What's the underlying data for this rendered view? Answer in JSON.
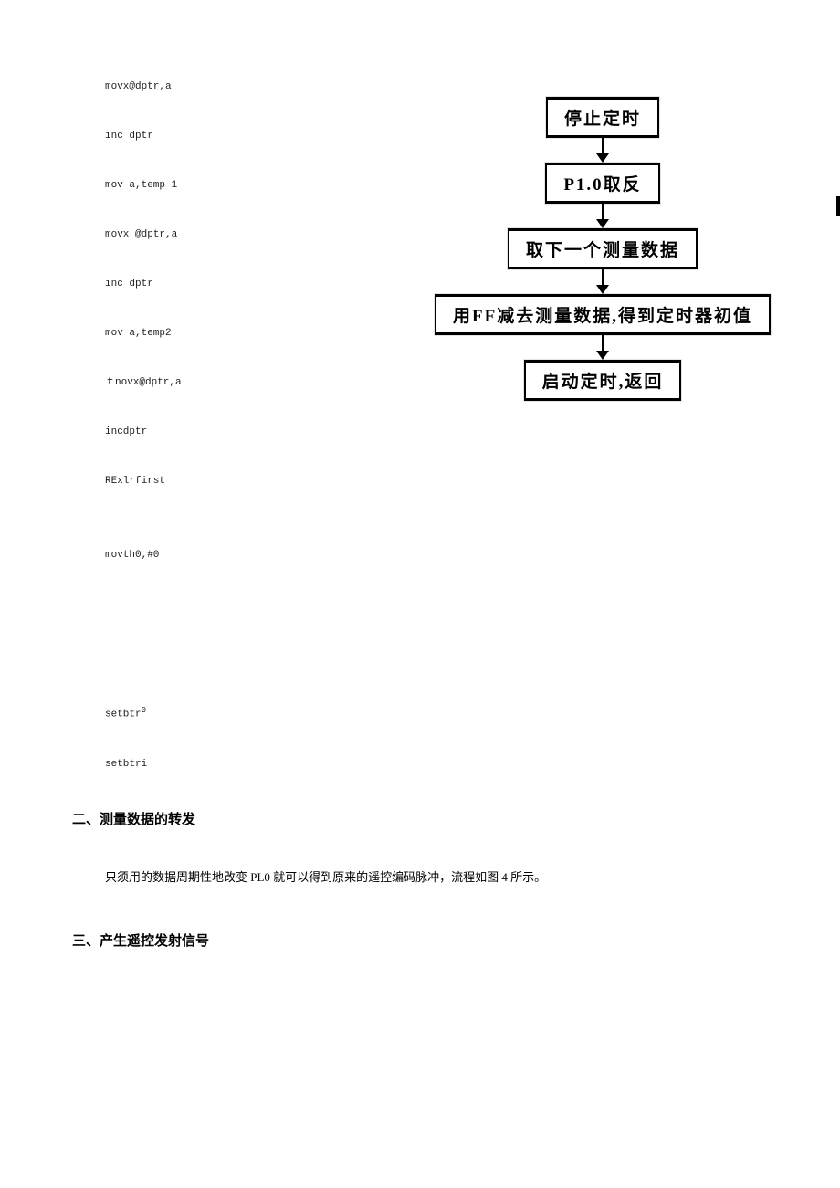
{
  "code": {
    "l1": "movx@dptr,a",
    "l2": "inc dptr",
    "l3": "mov a,temp 1",
    "l4": "movx @dptr,a",
    "l5": "inc dptr",
    "l6": "mov a,temp2",
    "l7": "ｔnovx@dptr,a",
    "l8": "incdptr",
    "l9": "RExlrfirst",
    "l10": "movth0,#0",
    "l11": "setbtr",
    "l11sup": "0",
    "l12": "setbtri"
  },
  "flowchart": {
    "b1": "停止定时",
    "b2": "P1.0取反",
    "b3": "取下一个测量数据",
    "b4": "用FF减去测量数据,得到定时器初值",
    "b5": "启动定时,返回"
  },
  "sections": {
    "h2": "二、测量数据的转发",
    "p2": "只须用的数据周期性地改变 PL0 就可以得到原来的遥控编码脉冲，流程如图 4 所示。",
    "h3": "三、产生遥控发射信号"
  }
}
